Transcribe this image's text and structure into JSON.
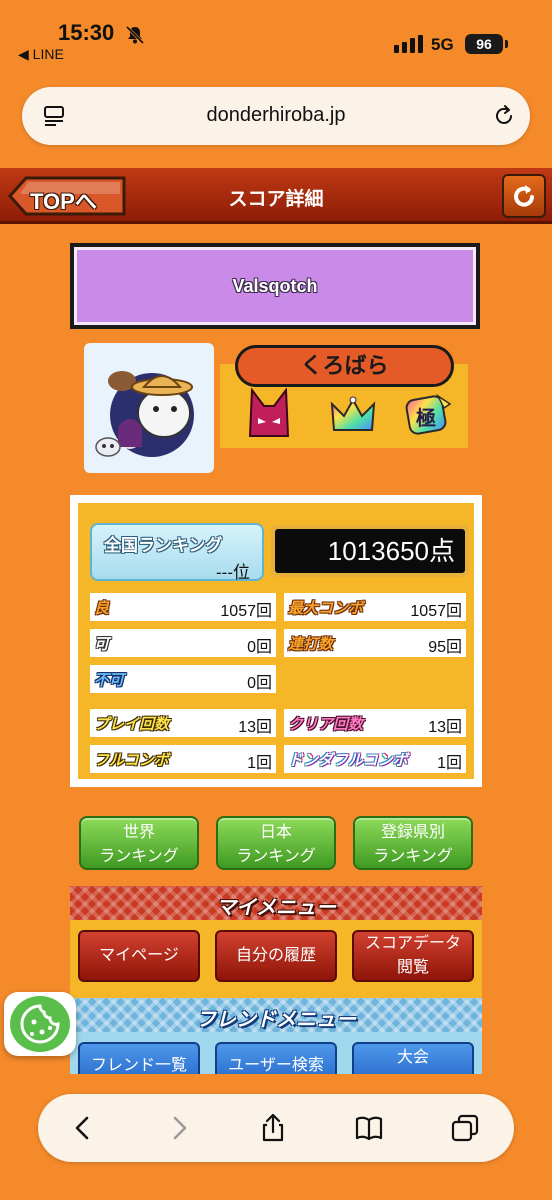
{
  "status_bar": {
    "time": "15:30",
    "back_app": "◀ LINE",
    "network": "5G",
    "battery": "96",
    "icons": [
      "bell-slash-icon",
      "signal-icon"
    ]
  },
  "browser": {
    "url": "donderhiroba.jp",
    "icons": [
      "reader-icon",
      "reload-icon"
    ]
  },
  "header": {
    "top_label": "TOPへ",
    "title": "スコア詳細",
    "refresh_icon": "refresh-icon"
  },
  "player": {
    "name": "Valsqotch"
  },
  "song": {
    "title": "くろばら",
    "badges": [
      "oni-difficulty-icon",
      "crown-icon",
      "kiwami-icon"
    ],
    "badge_text": "極"
  },
  "score": {
    "rank_label": "全国ランキング",
    "rank_value": "---位",
    "points": "1013650点",
    "stats": {
      "good": {
        "label": "良",
        "value": "1057回"
      },
      "max_combo": {
        "label": "最大コンボ",
        "value": "1057回"
      },
      "ok": {
        "label": "可",
        "value": "0回"
      },
      "drumroll": {
        "label": "連打数",
        "value": "95回"
      },
      "bad": {
        "label": "不可",
        "value": "0回"
      },
      "play_count": {
        "label": "プレイ回数",
        "value": "13回"
      },
      "clear_count": {
        "label": "クリア回数",
        "value": "13回"
      },
      "full_combo": {
        "label": "フルコンボ",
        "value": "1回"
      },
      "donderful_combo": {
        "label": "ドンダフルコンボ",
        "value": "1回"
      }
    }
  },
  "ranking_buttons": [
    {
      "line1": "世界",
      "line2": "ランキング"
    },
    {
      "line1": "日本",
      "line2": "ランキング"
    },
    {
      "line1": "登録県別",
      "line2": "ランキング"
    }
  ],
  "my_menu": {
    "title": "マイメニュー",
    "items": [
      {
        "line1": "マイページ",
        "line2": ""
      },
      {
        "line1": "自分の履歴",
        "line2": ""
      },
      {
        "line1": "スコアデータ",
        "line2": "閲覧"
      }
    ]
  },
  "friend_menu": {
    "title": "フレンドメニュー",
    "items": [
      {
        "line1": "フレンド一覧"
      },
      {
        "line1": "ユーザー検索"
      },
      {
        "line1": "大会"
      }
    ]
  },
  "colors": {
    "page_bg": "#F58A2A",
    "header_red": "#B0300F",
    "player_purple": "#C98BE7",
    "panel_yellow": "#F5B628",
    "green_button": "#5CB838",
    "red_button": "#B92A1A",
    "blue_button": "#2F72D6"
  },
  "toolbar_icons": [
    "back-icon",
    "forward-icon",
    "share-icon",
    "bookmarks-icon",
    "tabs-icon"
  ]
}
